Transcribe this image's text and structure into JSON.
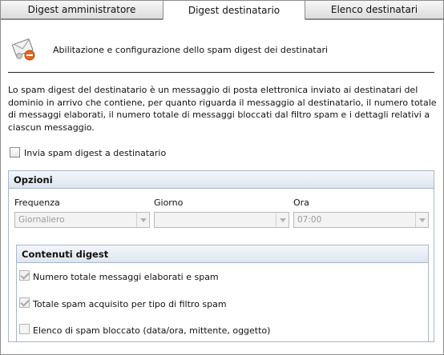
{
  "tabs": [
    {
      "label": "Digest amministratore"
    },
    {
      "label": "Digest destinatario"
    },
    {
      "label": "Elenco destinatari"
    }
  ],
  "header": {
    "icon": "mail-settings-icon",
    "title": "Abilitazione e configurazione dello spam digest dei destinatari"
  },
  "description": "Lo spam digest del destinatario è un messaggio di posta elettronica inviato ai destinatari del dominio in arrivo che contiene, per quanto riguarda il messaggio al destinatario, il numero totale di messaggi elaborati, il numero totale di messaggi bloccati dal filtro spam e i dettagli relativi a ciascun messaggio.",
  "enable_checkbox": {
    "label": "Invia spam digest a destinatario",
    "checked": false
  },
  "options": {
    "title": "Opzioni",
    "frequency": {
      "label": "Frequenza",
      "value": "Giornaliero"
    },
    "day": {
      "label": "Giorno",
      "value": ""
    },
    "time": {
      "label": "Ora",
      "value": "07:00"
    }
  },
  "contents": {
    "title": "Contenuti digest",
    "items": [
      {
        "label": "Numero totale messaggi elaborati e spam",
        "checked": true,
        "disabled": true
      },
      {
        "label": "Totale spam acquisito per tipo di filtro spam",
        "checked": true,
        "disabled": true
      },
      {
        "label": "Elenco di spam bloccato (data/ora, mittente, oggetto)",
        "checked": false,
        "disabled": true
      }
    ]
  },
  "colors": {
    "group_border": "#a9b7c9",
    "group_header": "#dde5ef"
  }
}
